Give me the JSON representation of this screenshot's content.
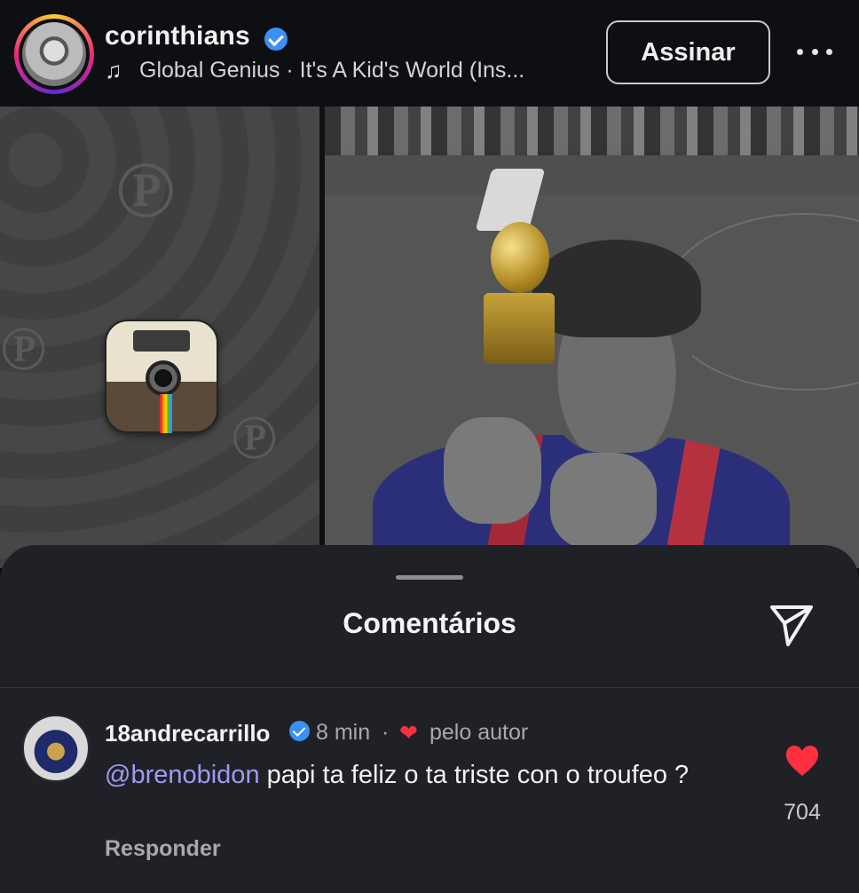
{
  "header": {
    "username": "corinthians",
    "music_icon": "music-note-icon",
    "music_text": "Global Genius · It's A Kid's World (Ins...",
    "subscribe_label": "Assinar",
    "more_icon": "more-horizontal-icon"
  },
  "sheet": {
    "title": "Comentários",
    "send_icon": "send-icon"
  },
  "comment": {
    "username": "18andrecarrillo",
    "time": "8 min",
    "separator": "·",
    "by_author": "pelo autor",
    "mention": "@brenobidon",
    "text": " papi ta feliz o ta triste con o troufeo ?",
    "reply_label": "Responder",
    "like_count": "704"
  },
  "colors": {
    "background": "#0b0b0d",
    "sheet": "#202127",
    "verified": "#3b8ff5",
    "like": "#ff3040",
    "mention": "#9d9cf2"
  }
}
